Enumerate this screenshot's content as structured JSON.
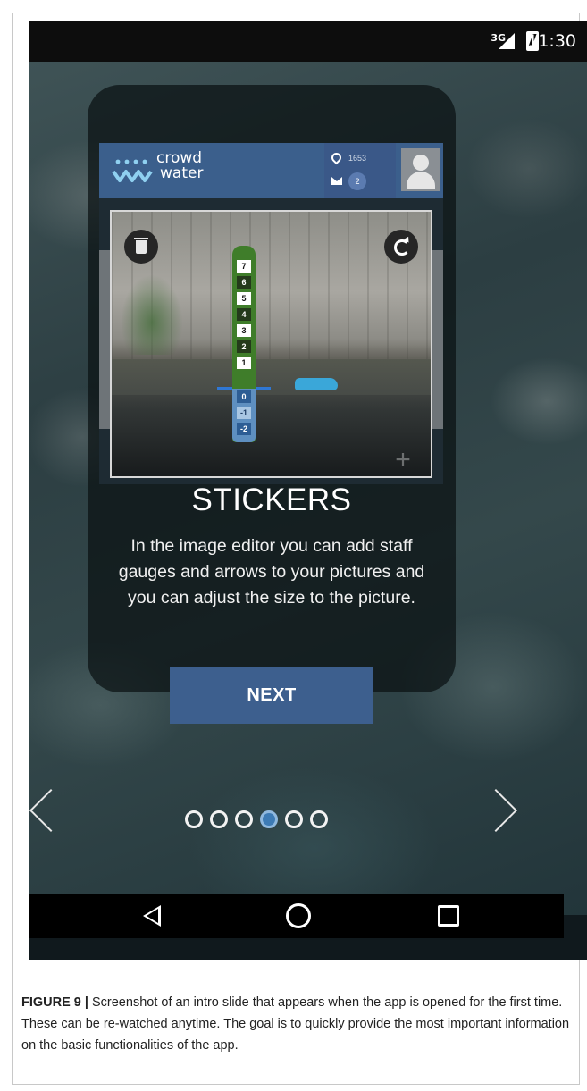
{
  "statusbar": {
    "network": "3G",
    "time": "11:30"
  },
  "app": {
    "logo_line1": "crowd",
    "logo_line2": "water",
    "drop_count": "1653",
    "mail_count": "2"
  },
  "gauge": {
    "top_cells": [
      "7",
      "6",
      "5",
      "4",
      "3",
      "2",
      "1"
    ],
    "zero": "0",
    "lower_cells": [
      "-1",
      "-2"
    ]
  },
  "slide": {
    "title": "STICKERS",
    "body": "In the image editor you can add staff gauges and arrows to your pictures and you can adjust the size to the picture.",
    "next_label": "NEXT",
    "total_pages": 6,
    "active_page": 4
  },
  "colors": {
    "accent": "#3d5f8e",
    "header": "#3b5f8c",
    "dot_active": "#3d7bb5"
  },
  "caption": {
    "label": "FIGURE 9 |",
    "text": " Screenshot of an intro slide that appears when the app is opened for the first time. These can be re-watched anytime. The goal is to quickly provide the most important information on the basic functionalities of the app."
  },
  "icons": [
    "signal-icon",
    "battery-icon",
    "drop-icon",
    "mail-icon",
    "avatar-icon",
    "trash-icon",
    "rotate-icon",
    "plus-icon",
    "chevron-left-icon",
    "chevron-right-icon",
    "nav-back-icon",
    "nav-home-icon",
    "nav-recents-icon"
  ]
}
